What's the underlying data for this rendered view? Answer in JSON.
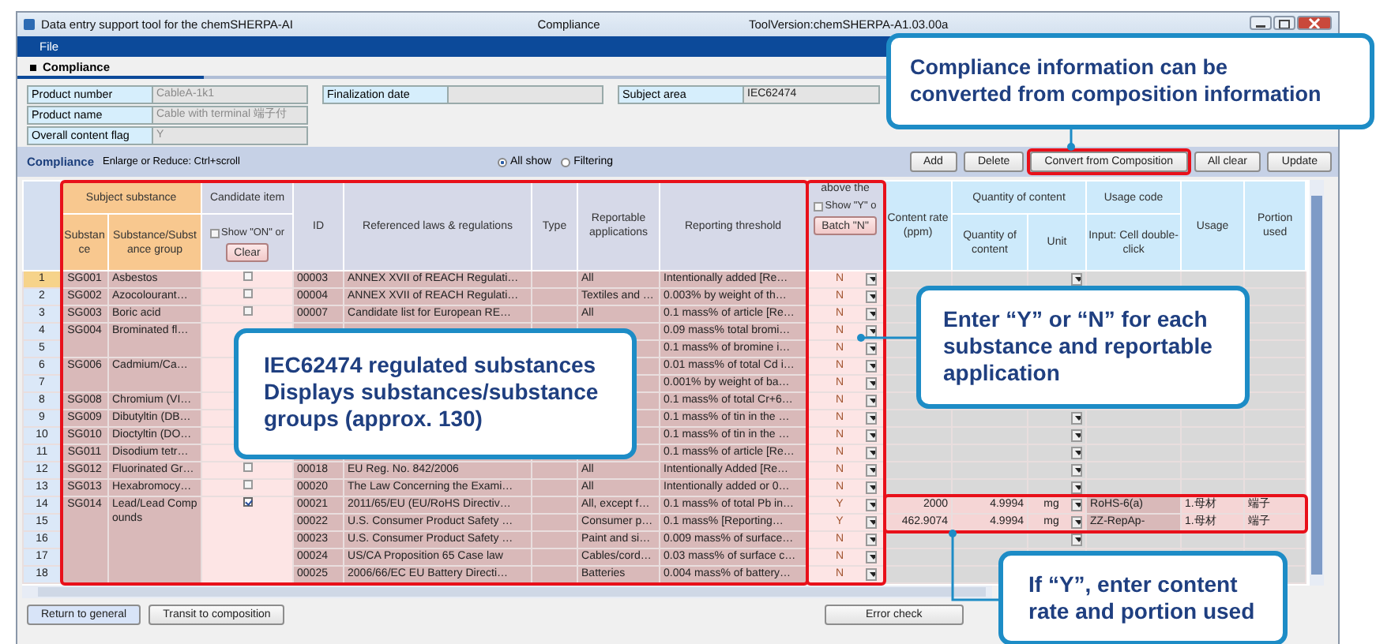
{
  "window": {
    "title": "Data entry support tool for the chemSHERPA-AI",
    "center_title": "Compliance",
    "version": "ToolVersion:chemSHERPA-A1.03.00a"
  },
  "menu": [
    "File"
  ],
  "tab": {
    "label": "Compliance"
  },
  "info_groups": [
    [
      {
        "label": "Product number",
        "value": "CableA-1k1",
        "disabled": true
      },
      {
        "label": "Product name",
        "value": "Cable with terminal 端子付",
        "disabled": true
      },
      {
        "label": "Overall content flag",
        "value": "Y",
        "disabled": true
      }
    ],
    [
      {
        "label": "Finalization date"
      }
    ],
    [
      {
        "label": "Subject area",
        "value": "IEC62474",
        "disabled": false
      }
    ]
  ],
  "toolbar": {
    "title": "Compliance",
    "hint": "Enlarge or Reduce: Ctrl+scroll",
    "view_options": [
      {
        "label": "All show",
        "selected": true
      },
      {
        "label": "Filtering",
        "selected": false
      }
    ],
    "buttons": [
      "Add",
      "Delete",
      "Convert from Composition",
      "All clear",
      "Update"
    ]
  },
  "table": {
    "header": {
      "subject_substance": "Subject substance",
      "substance_no": "Substance",
      "substance_group": "Substance/Substance group",
      "candidate": "Candidate item",
      "candidate_filter": {
        "label": "Show \"ON\" or",
        "checked": false
      },
      "clear": "Clear",
      "id": "ID",
      "law": "Referenced laws & regulations",
      "type": "Type",
      "applications": "Reportable applications",
      "threshold": "Reporting threshold",
      "above": "above the",
      "above_filter": {
        "label": "Show \"Y\" o",
        "checked": false
      },
      "batch": "Batch \"N\"",
      "rate": "Content rate (ppm)",
      "quantity_group": "Quantity of content",
      "quantity": "Quantity of content",
      "unit": "Unit",
      "usage_code": "Usage code",
      "usage_code_hint": "Input: Cell double-click",
      "usage": "Usage",
      "portion": "Portion used"
    },
    "rows": [
      {
        "no": "1",
        "selected": true,
        "substance_no": "SG001",
        "substance": "Asbestos",
        "candidate": false,
        "id": "00003",
        "law": "ANNEX XVII of REACH Regulati…",
        "applications": "All",
        "threshold": "Intentionally added [Re…",
        "above": "N",
        "unit_menu": true
      },
      {
        "no": "2",
        "selected": false,
        "substance_no": "SG002",
        "substance": "Azocolourant…",
        "candidate": false,
        "id": "00004",
        "law": "ANNEX XVII of REACH Regulati…",
        "applications": "Textiles and …",
        "threshold": "0.003% by weight of th…",
        "above": "N",
        "unit_menu": false
      },
      {
        "no": "3",
        "selected": false,
        "substance_no": "SG003",
        "substance": "Boric acid",
        "candidate": false,
        "id": "00007",
        "law": "Candidate list for European RE…",
        "applications": "All",
        "threshold": "0.1 mass% of article [Re…",
        "above": "N",
        "unit_menu": false
      },
      {
        "no": "4",
        "selected": false,
        "substance_no": "SG004",
        "substance": "Brominated fl…",
        "threshold": "0.09 mass% total bromi…",
        "above": "N",
        "unit_menu": false
      },
      {
        "no": "5",
        "selected": false,
        "threshold": "0.1 mass% of bromine i…",
        "above": "N",
        "unit_menu": false
      },
      {
        "no": "6",
        "selected": false,
        "substance_no": "SG006",
        "substance": "Cadmium/Ca…",
        "threshold": "0.01 mass% of total Cd i…",
        "above": "N",
        "unit_menu": false
      },
      {
        "no": "7",
        "selected": false,
        "threshold": "0.001% by weight of ba…",
        "above": "N",
        "unit_menu": false
      },
      {
        "no": "8",
        "selected": false,
        "substance_no": "SG008",
        "substance": "Chromium (VI…",
        "threshold": "0.1 mass% of total Cr+6…",
        "above": "N",
        "unit_menu": false
      },
      {
        "no": "9",
        "selected": false,
        "substance_no": "SG009",
        "substance": "Dibutyltin (DB…",
        "threshold": "0.1 mass% of tin in the …",
        "above": "N",
        "unit_menu": true
      },
      {
        "no": "10",
        "selected": false,
        "substance_no": "SG010",
        "substance": "Dioctyltin (DO…",
        "threshold": "0.1 mass% of tin in the …",
        "above": "N",
        "unit_menu": true
      },
      {
        "no": "11",
        "selected": false,
        "substance_no": "SG011",
        "substance": "Disodium tetr…",
        "threshold": "0.1 mass% of article [Re…",
        "above": "N",
        "unit_menu": true
      },
      {
        "no": "12",
        "selected": false,
        "substance_no": "SG012",
        "substance": "Fluorinated Gr…",
        "candidate": false,
        "id": "00018",
        "law": "EU Reg. No. 842/2006",
        "applications": "All",
        "threshold": "Intentionally Added [Re…",
        "above": "N",
        "unit_menu": true
      },
      {
        "no": "13",
        "selected": false,
        "substance_no": "SG013",
        "substance": "Hexabromocy…",
        "candidate": false,
        "id": "00020",
        "law": "The Law Concerning the Exami…",
        "applications": "All",
        "threshold": "Intentionally added or 0…",
        "above": "N",
        "unit_menu": true
      },
      {
        "no": "14",
        "selected": false,
        "substance_no": "SG014",
        "substance": "Lead/Lead Compounds",
        "candidate": true,
        "id": "00021",
        "law": "2011/65/EU (EU/RoHS Directiv…",
        "applications": "All, except f…",
        "threshold": "0.1 mass% of total Pb in…",
        "above": "Y",
        "content_rate": "2000",
        "quantity": "4.9994",
        "unit": "mg",
        "unit_menu": true,
        "usage_code": "RoHS-6(a)",
        "usage": "1.母材",
        "portion": "端子"
      },
      {
        "no": "15",
        "selected": false,
        "id": "00022",
        "law": "U.S. Consumer Product Safety …",
        "applications": "Consumer p…",
        "threshold": "0.1 mass% [Reporting…",
        "above": "Y",
        "content_rate": "462.9074",
        "quantity": "4.9994",
        "unit": "mg",
        "unit_menu": true,
        "usage_code": "ZZ-RepAp-",
        "usage": "1.母材",
        "portion": "端子"
      },
      {
        "no": "16",
        "selected": false,
        "id": "00023",
        "law": "U.S. Consumer Product Safety …",
        "applications": "Paint and si…",
        "threshold": "0.009 mass% of surface…",
        "above": "N",
        "unit_menu": true
      },
      {
        "no": "17",
        "selected": false,
        "id": "00024",
        "law": "US/CA Proposition 65 Case law",
        "applications": "Cables/cord…",
        "threshold": "0.03 mass% of surface c…",
        "above": "N",
        "unit_menu": false
      },
      {
        "no": "18",
        "selected": false,
        "id": "00025",
        "law": "2006/66/EC EU Battery Directi…",
        "applications": "Batteries",
        "threshold": "0.004 mass% of battery…",
        "above": "N",
        "unit_menu": false
      }
    ]
  },
  "footer": {
    "buttons": [
      "Return to general",
      "Transit to composition"
    ],
    "check": "Error check"
  },
  "callouts": [
    "Compliance information can be\nconverted from composition information",
    "IEC62474 regulated substances\nDisplays substances/substance\ngroups (approx. 130)",
    "Enter “Y” or “N” for each\nsubstance and reportable\napplication",
    "If “Y”, enter content\nrate and portion used"
  ]
}
